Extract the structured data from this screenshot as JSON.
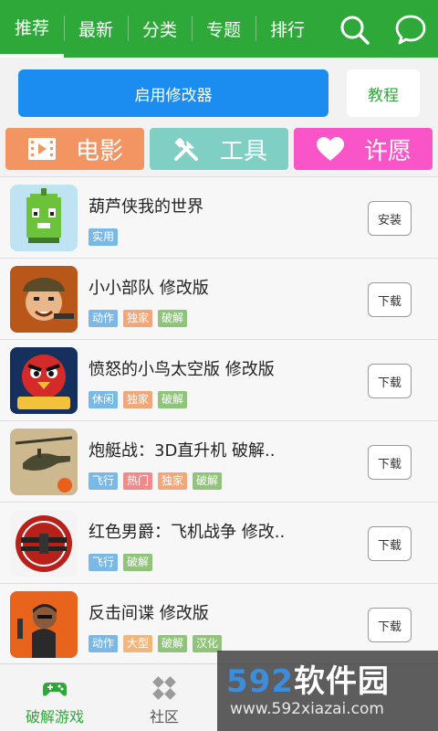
{
  "header": {
    "tabs": [
      {
        "label": "推荐",
        "active": true
      },
      {
        "label": "最新"
      },
      {
        "label": "分类"
      },
      {
        "label": "专题"
      },
      {
        "label": "排行"
      }
    ],
    "icons": [
      "search-icon",
      "chat-icon"
    ],
    "color": "#2fa83a"
  },
  "actions": {
    "primary_label": "启用修改器",
    "tutorial_label": "教程"
  },
  "categories": [
    {
      "label": "电影",
      "icon": "film-icon",
      "color": "#f29563"
    },
    {
      "label": "工具",
      "icon": "tools-icon",
      "color": "#7fcfc5"
    },
    {
      "label": "许愿",
      "icon": "heart-icon",
      "color": "#f955c9"
    }
  ],
  "apps": [
    {
      "title": "葫芦侠我的世界",
      "tags": [
        "实用"
      ],
      "button": "安装"
    },
    {
      "title": "小小部队  修改版",
      "tags": [
        "动作",
        "独家",
        "破解"
      ],
      "button": "下载"
    },
    {
      "title": "愤怒的小鸟太空版  修改版",
      "tags": [
        "休闲",
        "独家",
        "破解"
      ],
      "button": "下载"
    },
    {
      "title": "炮艇战：3D直升机  破解..",
      "tags": [
        "飞行",
        "热门",
        "独家",
        "破解"
      ],
      "button": "下载"
    },
    {
      "title": "红色男爵：飞机战争  修改..",
      "tags": [
        "飞行",
        "破解"
      ],
      "button": "下载"
    },
    {
      "title": "反击间谍    修改版",
      "tags": [
        "动作",
        "大型",
        "破解",
        "汉化"
      ],
      "button": "下载"
    }
  ],
  "tag_colors": {
    "实用": "#7ab8e8",
    "动作": "#7ab8e8",
    "休闲": "#7ab8e8",
    "飞行": "#7ab8e8",
    "独家": "#f2a77a",
    "大型": "#f2b57a",
    "热门": "#f28a8a",
    "破解": "#8fc47a",
    "汉化": "#8fc47a"
  },
  "bottom_nav": [
    {
      "label": "破解游戏",
      "icon": "gamepad-icon",
      "active": true
    },
    {
      "label": "社区",
      "icon": "community-icon"
    },
    {
      "label": "",
      "icon": "tab3-icon"
    },
    {
      "label": "",
      "icon": "tab4-icon"
    }
  ],
  "watermark": {
    "brand_num": "592",
    "brand_text": "软件园",
    "url": "www.592xiazai.com"
  }
}
